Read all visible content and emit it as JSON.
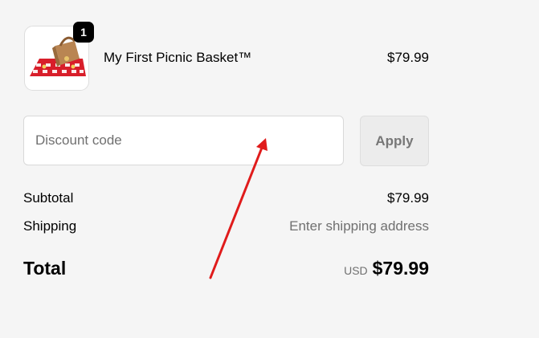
{
  "cart": {
    "item": {
      "name": "My First Picnic Basket™",
      "price": "$79.99",
      "quantity": "1",
      "image_icon": "picnic-basket-image"
    }
  },
  "discount": {
    "placeholder": "Discount code",
    "value": "",
    "apply_label": "Apply"
  },
  "summary": {
    "subtotal_label": "Subtotal",
    "subtotal_value": "$79.99",
    "shipping_label": "Shipping",
    "shipping_value": "Enter shipping address",
    "total_label": "Total",
    "currency": "USD",
    "total_value": "$79.99"
  },
  "colors": {
    "background": "#f5f5f5",
    "arrow": "#e01b1b",
    "muted_text": "#707070",
    "badge": "#000000"
  }
}
